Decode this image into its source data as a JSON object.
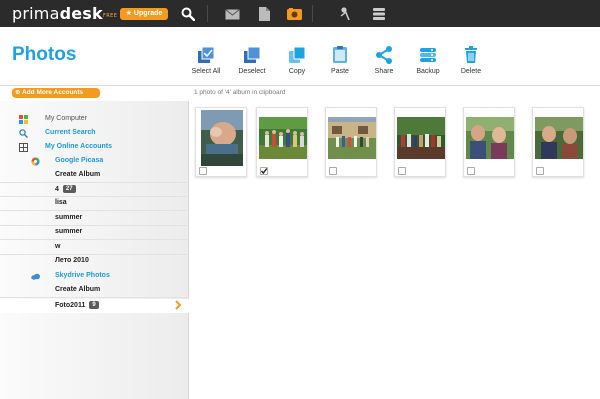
{
  "app": {
    "logo_prefix": "prima",
    "logo_brand": "desk",
    "logo_edition": "FREE",
    "upgrade_label": "★ Upgrade"
  },
  "topbar": {
    "icons": [
      "search-icon",
      "mail-icon",
      "document-icon",
      "photo-icon",
      "music-icon",
      "database-icon"
    ]
  },
  "header": {
    "title": "Photos"
  },
  "toolbar": {
    "select_all": "Select All",
    "deselect": "Deselect",
    "copy": "Copy",
    "paste": "Paste",
    "share": "Share",
    "backup": "Backup",
    "delete": "Delete"
  },
  "subbar": {
    "add_accounts": "Add More Accounts",
    "clipboard_status": "1 photo of '4' album in clipboard"
  },
  "sidebar": {
    "my_computer": "My Computer",
    "current_search": "Current Search",
    "my_online_accounts": "My Online Accounts",
    "picasa": "Google Picasa",
    "picasa_create": "Create Album",
    "albums": [
      {
        "name": "4",
        "count": "27"
      },
      {
        "name": "lisa"
      },
      {
        "name": "summer"
      },
      {
        "name": "summer"
      },
      {
        "name": "w"
      },
      {
        "name": "Лето 2010"
      }
    ],
    "skydrive": "Skydrive Photos",
    "skydrive_create": "Create Album",
    "skydrive_albums": [
      {
        "name": "Foto2011",
        "count": "9"
      }
    ]
  },
  "photos": [
    {
      "checked": false
    },
    {
      "checked": true
    },
    {
      "checked": false
    },
    {
      "checked": false
    },
    {
      "checked": false
    },
    {
      "checked": false
    }
  ],
  "colors": {
    "accent_blue": "#1fa3e0",
    "accent_orange": "#f39a1f",
    "topbar": "#2b2b2b"
  }
}
